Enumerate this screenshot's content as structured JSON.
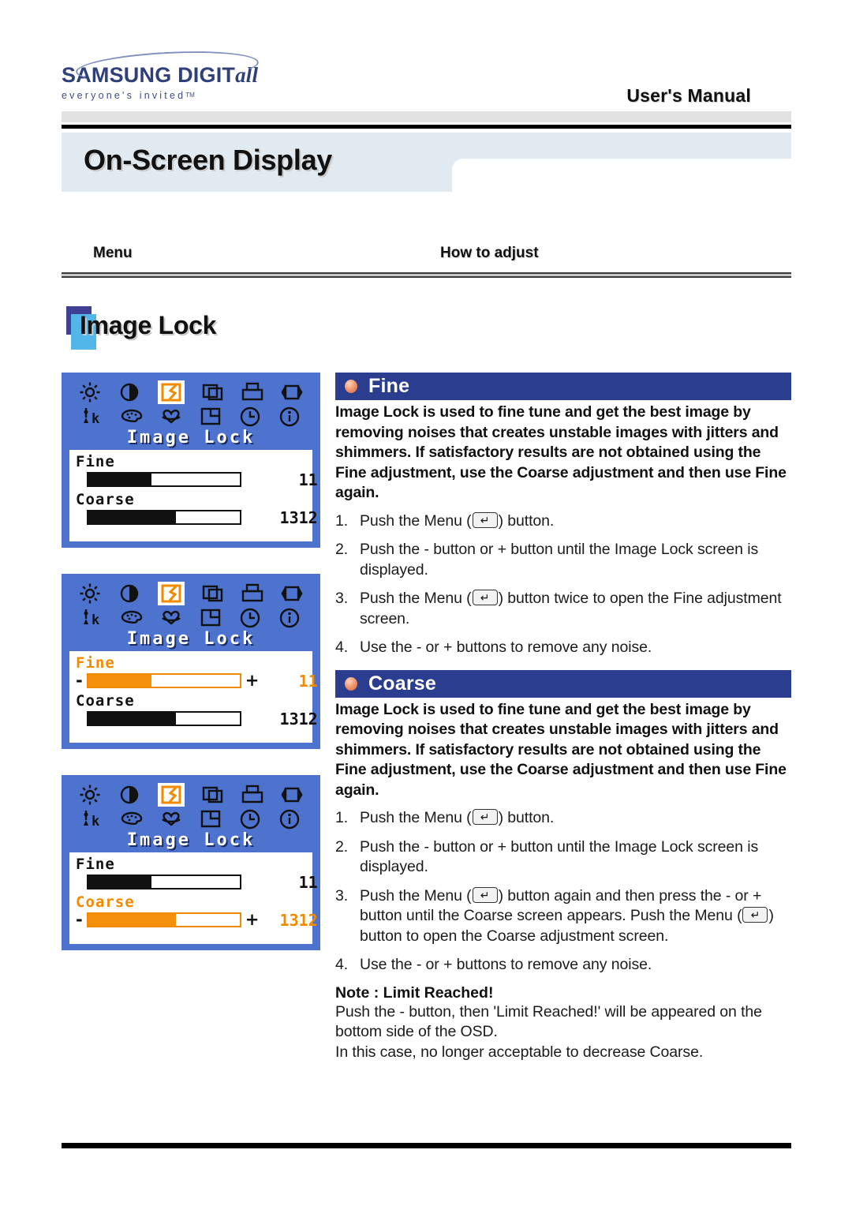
{
  "header": {
    "logo_main": "SAMSUNG DIGIT",
    "logo_italic": "all",
    "logo_tagline": "everyone's invited",
    "logo_tm": "TM",
    "manual_label": "User's Manual"
  },
  "page": {
    "title": "On-Screen Display",
    "section_title": "Image Lock"
  },
  "columns": {
    "menu": "Menu",
    "how_to_adjust": "How to adjust"
  },
  "osd_screens": [
    {
      "name": "image-lock-overview",
      "title": "Image Lock",
      "rows": [
        {
          "label": "Fine",
          "value": "11",
          "fill_percent": 42,
          "highlighted": false,
          "show_signs": false
        },
        {
          "label": "Coarse",
          "value": "1312",
          "fill_percent": 58,
          "highlighted": false,
          "show_signs": false
        }
      ]
    },
    {
      "name": "image-lock-fine-selected",
      "title": "Image Lock",
      "rows": [
        {
          "label": "Fine",
          "value": "11",
          "fill_percent": 42,
          "highlighted": true,
          "show_signs": true,
          "minus": "-",
          "plus": "+"
        },
        {
          "label": "Coarse",
          "value": "1312",
          "fill_percent": 58,
          "highlighted": false,
          "show_signs": false
        }
      ]
    },
    {
      "name": "image-lock-coarse-selected",
      "title": "Image Lock",
      "rows": [
        {
          "label": "Fine",
          "value": "11",
          "fill_percent": 42,
          "highlighted": false,
          "show_signs": false
        },
        {
          "label": "Coarse",
          "value": "1312",
          "fill_percent": 58,
          "highlighted": true,
          "show_signs": true,
          "minus": "-",
          "plus": "+"
        }
      ]
    }
  ],
  "osd_icons": {
    "row1": [
      "brightness-icon",
      "contrast-icon",
      "image-lock-icon",
      "position-icon",
      "reset-icon",
      "source-icon"
    ],
    "row2": [
      "color-temperature-icon",
      "color-palette-icon",
      "color-tone-icon",
      "menu-position-icon",
      "osd-timer-icon",
      "information-icon"
    ],
    "selected_index": 2
  },
  "sections": [
    {
      "name": "fine",
      "heading": "Fine",
      "body": "Image Lock is used to fine tune and get the best image by removing noises that creates unstable images with jitters and shimmers. If satisfactory results are not obtained using the Fine adjustment, use the Coarse adjustment and then use Fine again.",
      "steps": [
        {
          "num": "1.",
          "before": "Push the Menu (",
          "after": ") button."
        },
        {
          "num": "2.",
          "before": "Push the - button or + button until the Image Lock screen is displayed.",
          "after": ""
        },
        {
          "num": "3.",
          "before": "Push the Menu (",
          "after": ") button twice to open the Fine adjustment screen."
        },
        {
          "num": "4.",
          "before": "Use the - or + buttons to remove any noise.",
          "after": ""
        }
      ]
    },
    {
      "name": "coarse",
      "heading": "Coarse",
      "body": "Image Lock is used to fine tune and get the best image by removing noises that creates unstable images with jitters and shimmers. If satisfactory results are not obtained using the Fine adjustment, use the Coarse adjustment and then use Fine again.",
      "steps": [
        {
          "num": "1.",
          "before": "Push the Menu (",
          "after": ") button."
        },
        {
          "num": "2.",
          "before": "Push the - button or + button until the Image Lock screen is displayed.",
          "after": ""
        },
        {
          "num": "3.",
          "before": "Push the Menu (",
          "mid": ") button again and then  press the - or + button until the Coarse screen appears. Push the Menu (",
          "after": ") button to open the Coarse adjustment screen."
        },
        {
          "num": "4.",
          "before": "Use the - or + buttons to remove any noise.",
          "after": ""
        }
      ]
    }
  ],
  "note": {
    "title": "Note : Limit Reached!",
    "line1": "Push the - button, then 'Limit Reached!' will be appeared on the bottom side of the OSD.",
    "line2": "In this case, no longer acceptable to decrease Coarse."
  },
  "colors": {
    "osd_background": "#4e73cf",
    "osd_highlight": "#f08a00",
    "section_header": "#2b3d8f",
    "title_band": "#e1eaf1",
    "brand_blue": "#2f3f7a"
  }
}
